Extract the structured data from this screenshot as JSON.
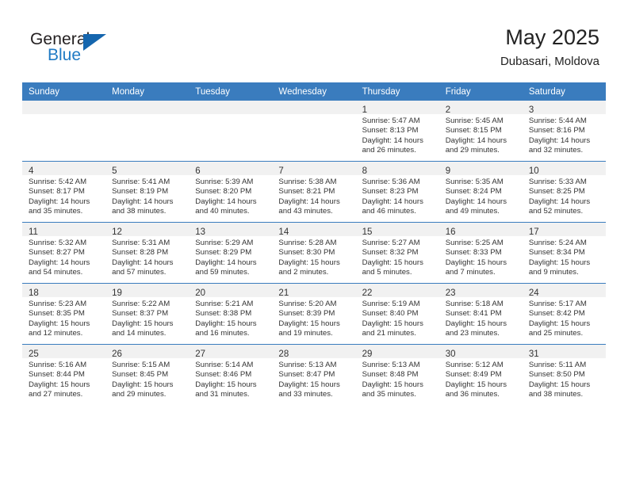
{
  "brand": {
    "name_top": "General",
    "name_bottom": "Blue",
    "color_primary": "#1566ae",
    "color_text": "#231f20"
  },
  "header": {
    "title": "May 2025",
    "subtitle": "Dubasari, Moldova"
  },
  "theme": {
    "header_row_bg": "#3a7cbe",
    "daynum_band_bg": "#f1f1f1",
    "cell_bg": "#ffffff",
    "divider": "#3a7cbe",
    "text": "#333333"
  },
  "weekday_headers": [
    "Sunday",
    "Monday",
    "Tuesday",
    "Wednesday",
    "Thursday",
    "Friday",
    "Saturday"
  ],
  "weeks": [
    [
      {
        "day": "",
        "lines": []
      },
      {
        "day": "",
        "lines": []
      },
      {
        "day": "",
        "lines": []
      },
      {
        "day": "",
        "lines": []
      },
      {
        "day": "1",
        "lines": [
          "Sunrise: 5:47 AM",
          "Sunset: 8:13 PM",
          "Daylight: 14 hours",
          "and 26 minutes."
        ]
      },
      {
        "day": "2",
        "lines": [
          "Sunrise: 5:45 AM",
          "Sunset: 8:15 PM",
          "Daylight: 14 hours",
          "and 29 minutes."
        ]
      },
      {
        "day": "3",
        "lines": [
          "Sunrise: 5:44 AM",
          "Sunset: 8:16 PM",
          "Daylight: 14 hours",
          "and 32 minutes."
        ]
      }
    ],
    [
      {
        "day": "4",
        "lines": [
          "Sunrise: 5:42 AM",
          "Sunset: 8:17 PM",
          "Daylight: 14 hours",
          "and 35 minutes."
        ]
      },
      {
        "day": "5",
        "lines": [
          "Sunrise: 5:41 AM",
          "Sunset: 8:19 PM",
          "Daylight: 14 hours",
          "and 38 minutes."
        ]
      },
      {
        "day": "6",
        "lines": [
          "Sunrise: 5:39 AM",
          "Sunset: 8:20 PM",
          "Daylight: 14 hours",
          "and 40 minutes."
        ]
      },
      {
        "day": "7",
        "lines": [
          "Sunrise: 5:38 AM",
          "Sunset: 8:21 PM",
          "Daylight: 14 hours",
          "and 43 minutes."
        ]
      },
      {
        "day": "8",
        "lines": [
          "Sunrise: 5:36 AM",
          "Sunset: 8:23 PM",
          "Daylight: 14 hours",
          "and 46 minutes."
        ]
      },
      {
        "day": "9",
        "lines": [
          "Sunrise: 5:35 AM",
          "Sunset: 8:24 PM",
          "Daylight: 14 hours",
          "and 49 minutes."
        ]
      },
      {
        "day": "10",
        "lines": [
          "Sunrise: 5:33 AM",
          "Sunset: 8:25 PM",
          "Daylight: 14 hours",
          "and 52 minutes."
        ]
      }
    ],
    [
      {
        "day": "11",
        "lines": [
          "Sunrise: 5:32 AM",
          "Sunset: 8:27 PM",
          "Daylight: 14 hours",
          "and 54 minutes."
        ]
      },
      {
        "day": "12",
        "lines": [
          "Sunrise: 5:31 AM",
          "Sunset: 8:28 PM",
          "Daylight: 14 hours",
          "and 57 minutes."
        ]
      },
      {
        "day": "13",
        "lines": [
          "Sunrise: 5:29 AM",
          "Sunset: 8:29 PM",
          "Daylight: 14 hours",
          "and 59 minutes."
        ]
      },
      {
        "day": "14",
        "lines": [
          "Sunrise: 5:28 AM",
          "Sunset: 8:30 PM",
          "Daylight: 15 hours",
          "and 2 minutes."
        ]
      },
      {
        "day": "15",
        "lines": [
          "Sunrise: 5:27 AM",
          "Sunset: 8:32 PM",
          "Daylight: 15 hours",
          "and 5 minutes."
        ]
      },
      {
        "day": "16",
        "lines": [
          "Sunrise: 5:25 AM",
          "Sunset: 8:33 PM",
          "Daylight: 15 hours",
          "and 7 minutes."
        ]
      },
      {
        "day": "17",
        "lines": [
          "Sunrise: 5:24 AM",
          "Sunset: 8:34 PM",
          "Daylight: 15 hours",
          "and 9 minutes."
        ]
      }
    ],
    [
      {
        "day": "18",
        "lines": [
          "Sunrise: 5:23 AM",
          "Sunset: 8:35 PM",
          "Daylight: 15 hours",
          "and 12 minutes."
        ]
      },
      {
        "day": "19",
        "lines": [
          "Sunrise: 5:22 AM",
          "Sunset: 8:37 PM",
          "Daylight: 15 hours",
          "and 14 minutes."
        ]
      },
      {
        "day": "20",
        "lines": [
          "Sunrise: 5:21 AM",
          "Sunset: 8:38 PM",
          "Daylight: 15 hours",
          "and 16 minutes."
        ]
      },
      {
        "day": "21",
        "lines": [
          "Sunrise: 5:20 AM",
          "Sunset: 8:39 PM",
          "Daylight: 15 hours",
          "and 19 minutes."
        ]
      },
      {
        "day": "22",
        "lines": [
          "Sunrise: 5:19 AM",
          "Sunset: 8:40 PM",
          "Daylight: 15 hours",
          "and 21 minutes."
        ]
      },
      {
        "day": "23",
        "lines": [
          "Sunrise: 5:18 AM",
          "Sunset: 8:41 PM",
          "Daylight: 15 hours",
          "and 23 minutes."
        ]
      },
      {
        "day": "24",
        "lines": [
          "Sunrise: 5:17 AM",
          "Sunset: 8:42 PM",
          "Daylight: 15 hours",
          "and 25 minutes."
        ]
      }
    ],
    [
      {
        "day": "25",
        "lines": [
          "Sunrise: 5:16 AM",
          "Sunset: 8:44 PM",
          "Daylight: 15 hours",
          "and 27 minutes."
        ]
      },
      {
        "day": "26",
        "lines": [
          "Sunrise: 5:15 AM",
          "Sunset: 8:45 PM",
          "Daylight: 15 hours",
          "and 29 minutes."
        ]
      },
      {
        "day": "27",
        "lines": [
          "Sunrise: 5:14 AM",
          "Sunset: 8:46 PM",
          "Daylight: 15 hours",
          "and 31 minutes."
        ]
      },
      {
        "day": "28",
        "lines": [
          "Sunrise: 5:13 AM",
          "Sunset: 8:47 PM",
          "Daylight: 15 hours",
          "and 33 minutes."
        ]
      },
      {
        "day": "29",
        "lines": [
          "Sunrise: 5:13 AM",
          "Sunset: 8:48 PM",
          "Daylight: 15 hours",
          "and 35 minutes."
        ]
      },
      {
        "day": "30",
        "lines": [
          "Sunrise: 5:12 AM",
          "Sunset: 8:49 PM",
          "Daylight: 15 hours",
          "and 36 minutes."
        ]
      },
      {
        "day": "31",
        "lines": [
          "Sunrise: 5:11 AM",
          "Sunset: 8:50 PM",
          "Daylight: 15 hours",
          "and 38 minutes."
        ]
      }
    ]
  ]
}
